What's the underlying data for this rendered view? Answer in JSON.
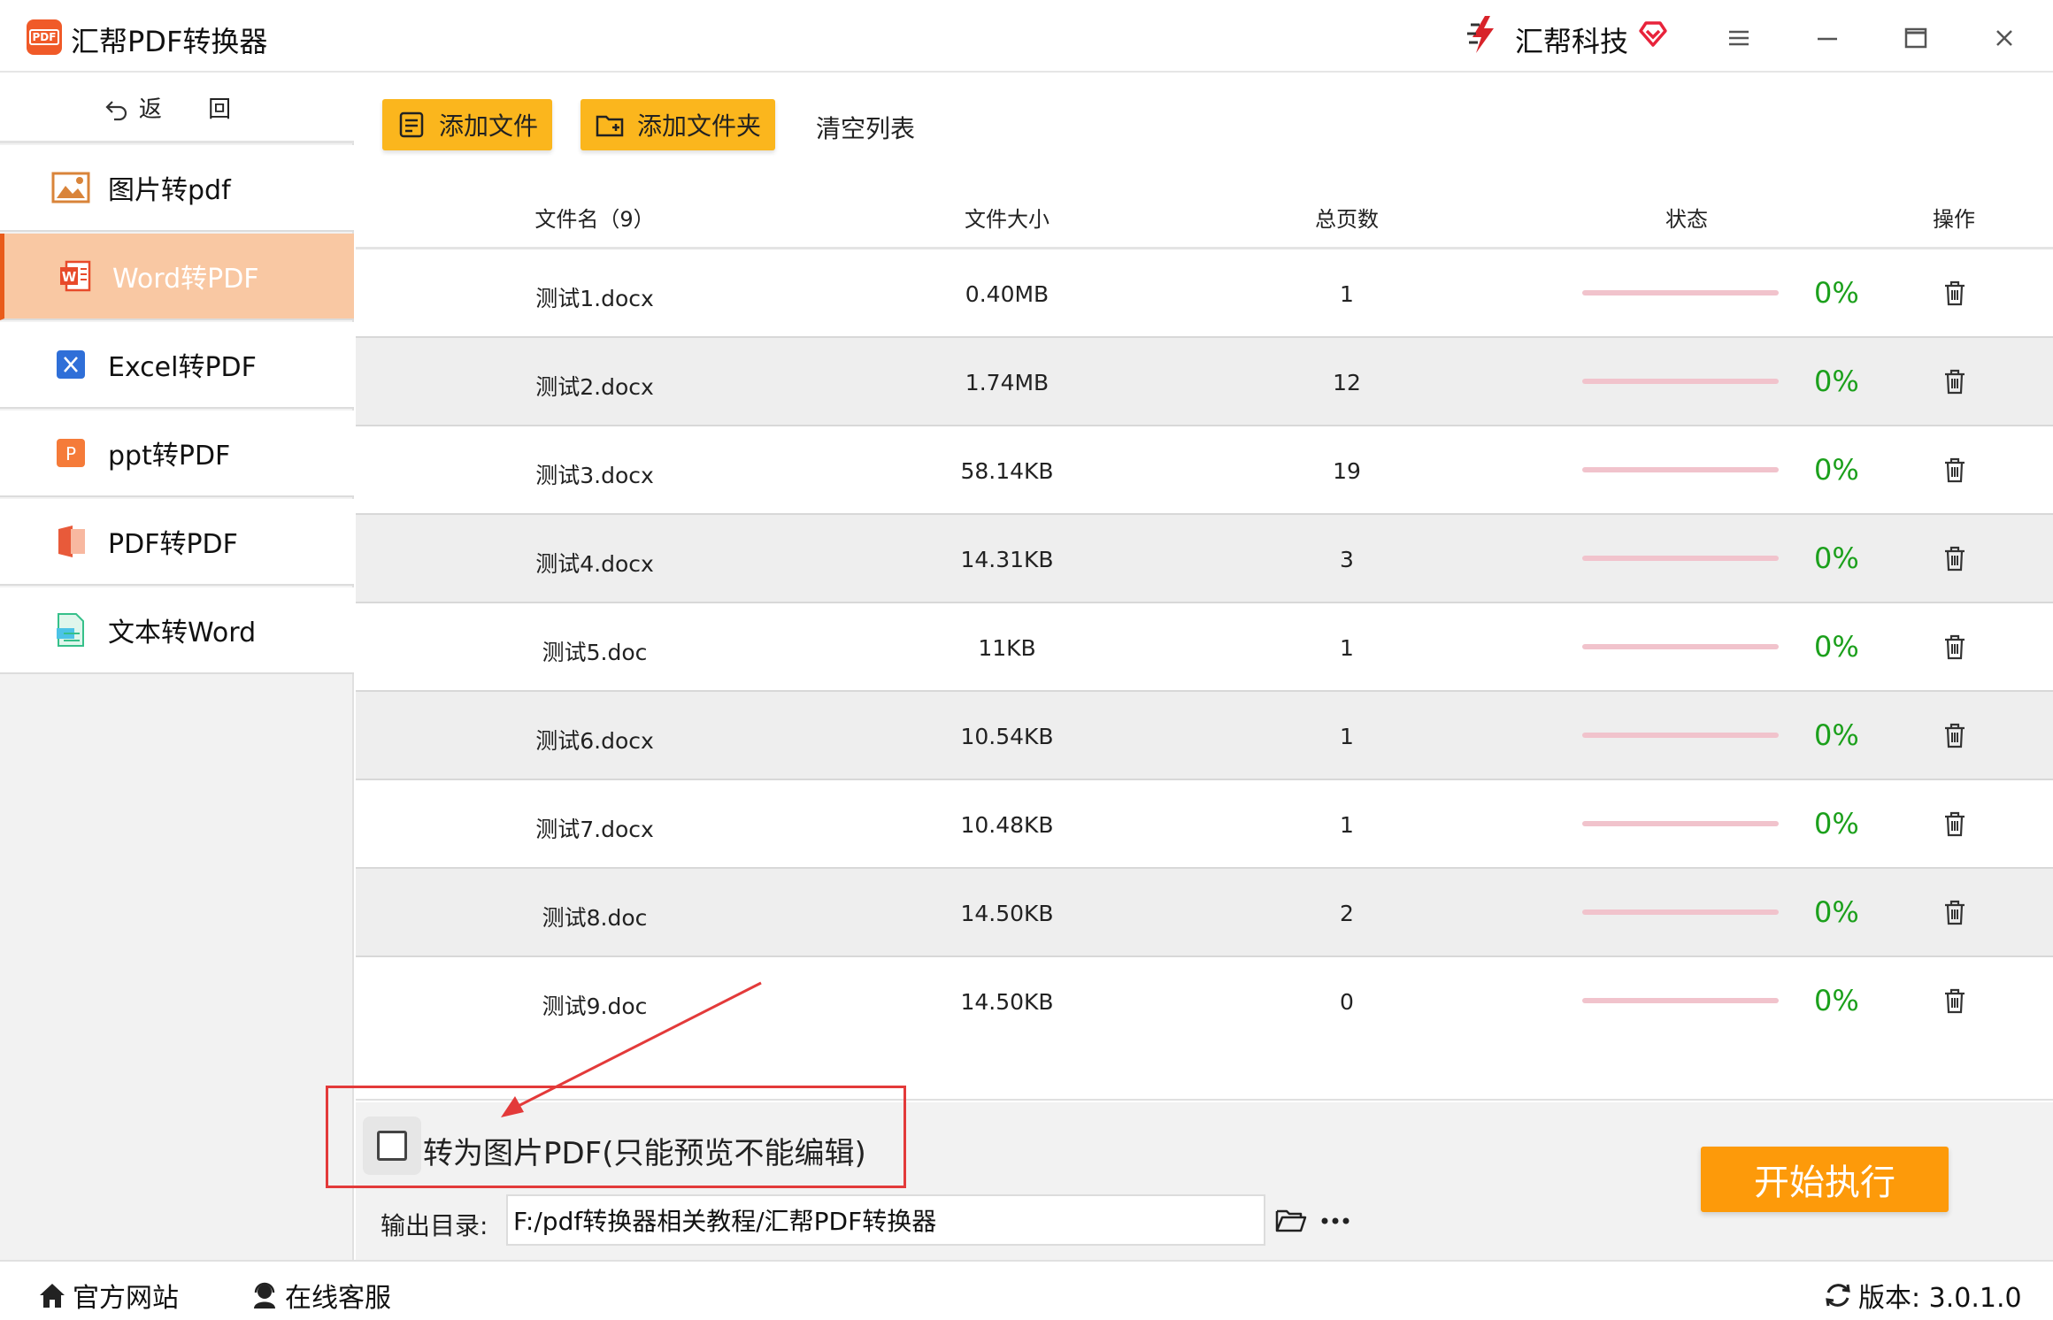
{
  "app": {
    "title": "汇帮PDF转换器",
    "logo_text": "PDF",
    "brand": "汇帮科技"
  },
  "sidebar": {
    "back_label": "返 回",
    "items": [
      {
        "label": "图片转pdf",
        "icon": "image-icon",
        "active": false
      },
      {
        "label": "Word转PDF",
        "icon": "word-icon",
        "active": true
      },
      {
        "label": "Excel转PDF",
        "icon": "excel-icon",
        "active": false
      },
      {
        "label": "ppt转PDF",
        "icon": "ppt-icon",
        "active": false
      },
      {
        "label": "PDF转PDF",
        "icon": "pdf-icon",
        "active": false
      },
      {
        "label": "文本转Word",
        "icon": "text-doc-icon",
        "active": false
      }
    ]
  },
  "toolbar": {
    "add_file": "添加文件",
    "add_folder": "添加文件夹",
    "clear_list": "清空列表"
  },
  "table": {
    "headers": {
      "name": "文件名（9）",
      "size": "文件大小",
      "pages": "总页数",
      "status": "状态",
      "action": "操作"
    },
    "rows": [
      {
        "name": "测试1.docx",
        "size": "0.40MB",
        "pages": "1",
        "progress": 0,
        "pct": "0%"
      },
      {
        "name": "测试2.docx",
        "size": "1.74MB",
        "pages": "12",
        "progress": 0,
        "pct": "0%"
      },
      {
        "name": "测试3.docx",
        "size": "58.14KB",
        "pages": "19",
        "progress": 0,
        "pct": "0%"
      },
      {
        "name": "测试4.docx",
        "size": "14.31KB",
        "pages": "3",
        "progress": 0,
        "pct": "0%"
      },
      {
        "name": "测试5.doc",
        "size": "11KB",
        "pages": "1",
        "progress": 0,
        "pct": "0%"
      },
      {
        "name": "测试6.docx",
        "size": "10.54KB",
        "pages": "1",
        "progress": 0,
        "pct": "0%"
      },
      {
        "name": "测试7.docx",
        "size": "10.48KB",
        "pages": "1",
        "progress": 0,
        "pct": "0%"
      },
      {
        "name": "测试8.doc",
        "size": "14.50KB",
        "pages": "2",
        "progress": 0,
        "pct": "0%"
      },
      {
        "name": "测试9.doc",
        "size": "14.50KB",
        "pages": "0",
        "progress": 0,
        "pct": "0%"
      }
    ]
  },
  "options": {
    "image_pdf_label": "转为图片PDF(只能预览不能编辑)",
    "image_pdf_checked": false
  },
  "output": {
    "label": "输出目录:",
    "path": "F:/pdf转换器相关教程/汇帮PDF转换器"
  },
  "start_button": "开始执行",
  "footer": {
    "website": "官方网站",
    "support": "在线客服",
    "version": "版本: 3.0.1.0"
  },
  "colors": {
    "accent": "#fbb61d",
    "active_item": "#f9c8a3",
    "active_border": "#e95b1a",
    "start": "#fd9a0a",
    "percent": "#1ca01c",
    "annotation": "#e33a3a"
  }
}
